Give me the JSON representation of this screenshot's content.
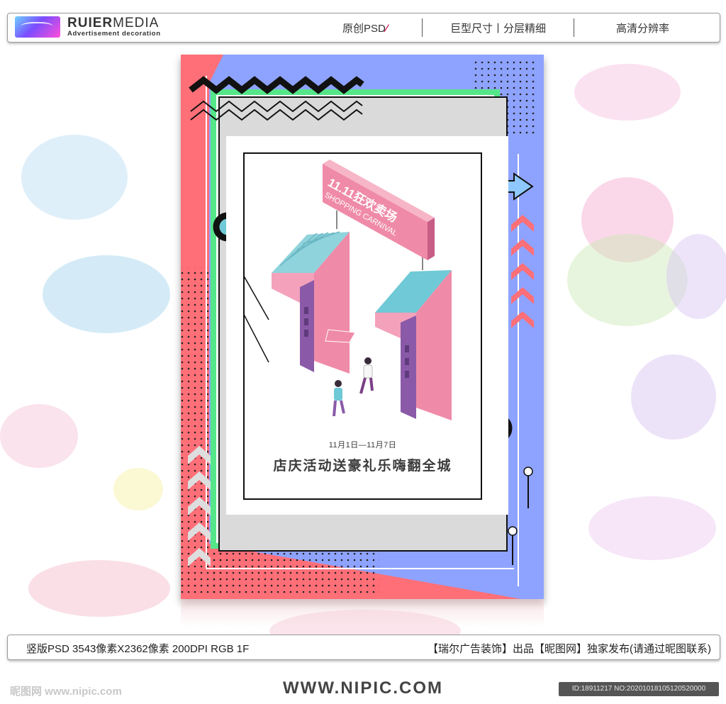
{
  "header": {
    "brand_name_bold": "RUIER",
    "brand_name_light": "MEDIA",
    "brand_subtitle": "Advertisement decoration",
    "items": [
      {
        "label": "原创PSD"
      },
      {
        "label": "巨型尺寸丨分层精细"
      },
      {
        "label": "高清分辨率"
      }
    ]
  },
  "poster": {
    "sign_title": "11.11狂欢卖场",
    "sign_subtitle": "SHOPPING CARNIVAL",
    "date_range": "11月1日—11月7日",
    "slogan": "店庆活动送豪礼乐嗨翻全城"
  },
  "footer_info": {
    "specs": "竖版PSD 3543像素X2362像素 200DPI RGB 1F",
    "credit": "【瑞尔广告装饰】出品【昵图网】独家发布(请通过昵图联系)"
  },
  "footer": {
    "watermark": "昵图网 www.nipic.com",
    "site": "WWW.NIPIC.COM",
    "id": "ID:18911217 NO:20201018105120520000"
  },
  "colors": {
    "coral": "#ff6f78",
    "periwinkle": "#8ea3ff",
    "mint": "#55e68a",
    "panel_gray": "#dadada",
    "pink_block": "#ef8aa8",
    "teal_block": "#6fc9d6",
    "purple_window": "#8a5aa8"
  }
}
